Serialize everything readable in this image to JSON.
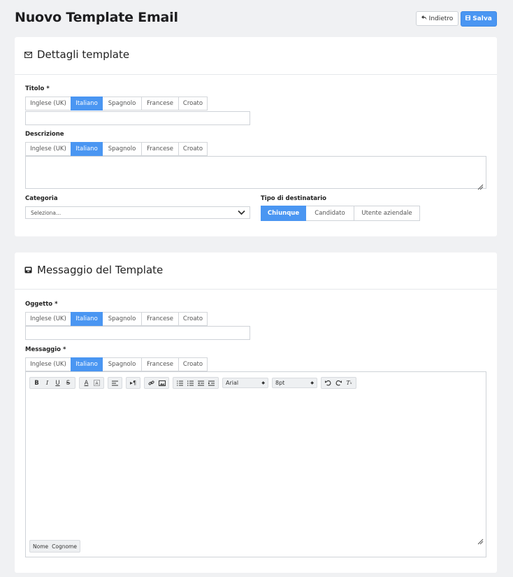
{
  "header": {
    "title": "Nuovo Template Email",
    "back_label": "Indietro",
    "save_label": "Salva"
  },
  "details": {
    "title": "Dettagli template",
    "title_label": "Titolo *",
    "description_label": "Descrizione",
    "category_label": "Categoria",
    "category_placeholder": "Seleziona...",
    "recipient_label": "Tipo di destinatario",
    "recipient_options": [
      "Chiunque",
      "Candidato",
      "Utente aziendale"
    ],
    "recipient_selected": "Chiunque"
  },
  "languages": [
    "Inglese (UK)",
    "Italiano",
    "Spagnolo",
    "Francese",
    "Croato"
  ],
  "active_language": "Italiano",
  "message": {
    "title": "Messaggio del Template",
    "subject_label": "Oggetto *",
    "message_label": "Messaggio *",
    "font_family": "Arial",
    "font_size": "8pt",
    "placeholders": [
      "Nome",
      "Cognome"
    ]
  },
  "colors": {
    "accent": "#4a96f2",
    "background": "#f0f1f3"
  }
}
